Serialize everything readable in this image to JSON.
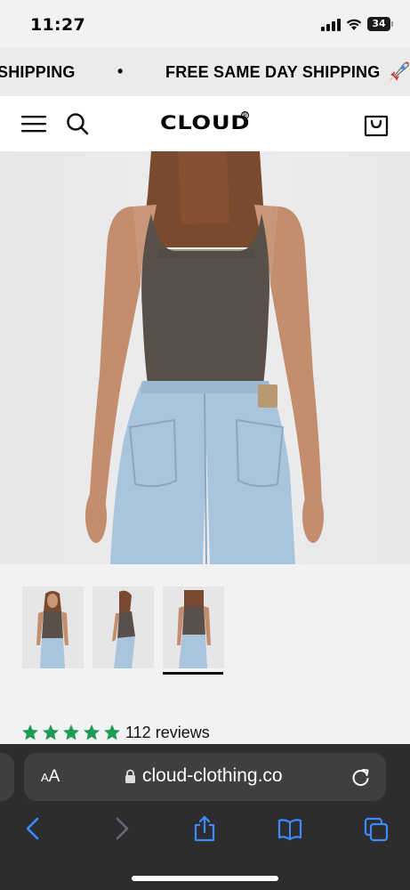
{
  "status_bar": {
    "time": "11:27",
    "battery": "34"
  },
  "announcement": {
    "left_fragment": "SHIPPING",
    "separator": "•",
    "message": "FREE SAME DAY SHIPPING",
    "icon": "rocket-icon"
  },
  "header": {
    "logo": "CLOUD",
    "logo_mark": "®",
    "icons": [
      "menu-icon",
      "search-icon",
      "bag-icon"
    ]
  },
  "product": {
    "gallery_selected_index": 3,
    "thumbnail_count": 3,
    "rating_stars": 5,
    "rating_max": 5,
    "star_color": "#1e9b54",
    "reviews_label": "112 reviews"
  },
  "browser": {
    "aa_small": "A",
    "aa_big": "A",
    "url": "cloud-clothing.co",
    "icons": [
      "lock-icon",
      "reload-icon",
      "back-icon",
      "forward-icon",
      "share-icon",
      "bookmarks-icon",
      "tabs-icon"
    ],
    "accent": "#3b8bff"
  },
  "colors": {
    "top_color": "#5a504a",
    "denim_color": "#a9c4dd",
    "skin_color": "#c89576",
    "hair_color": "#7a4a2e"
  }
}
